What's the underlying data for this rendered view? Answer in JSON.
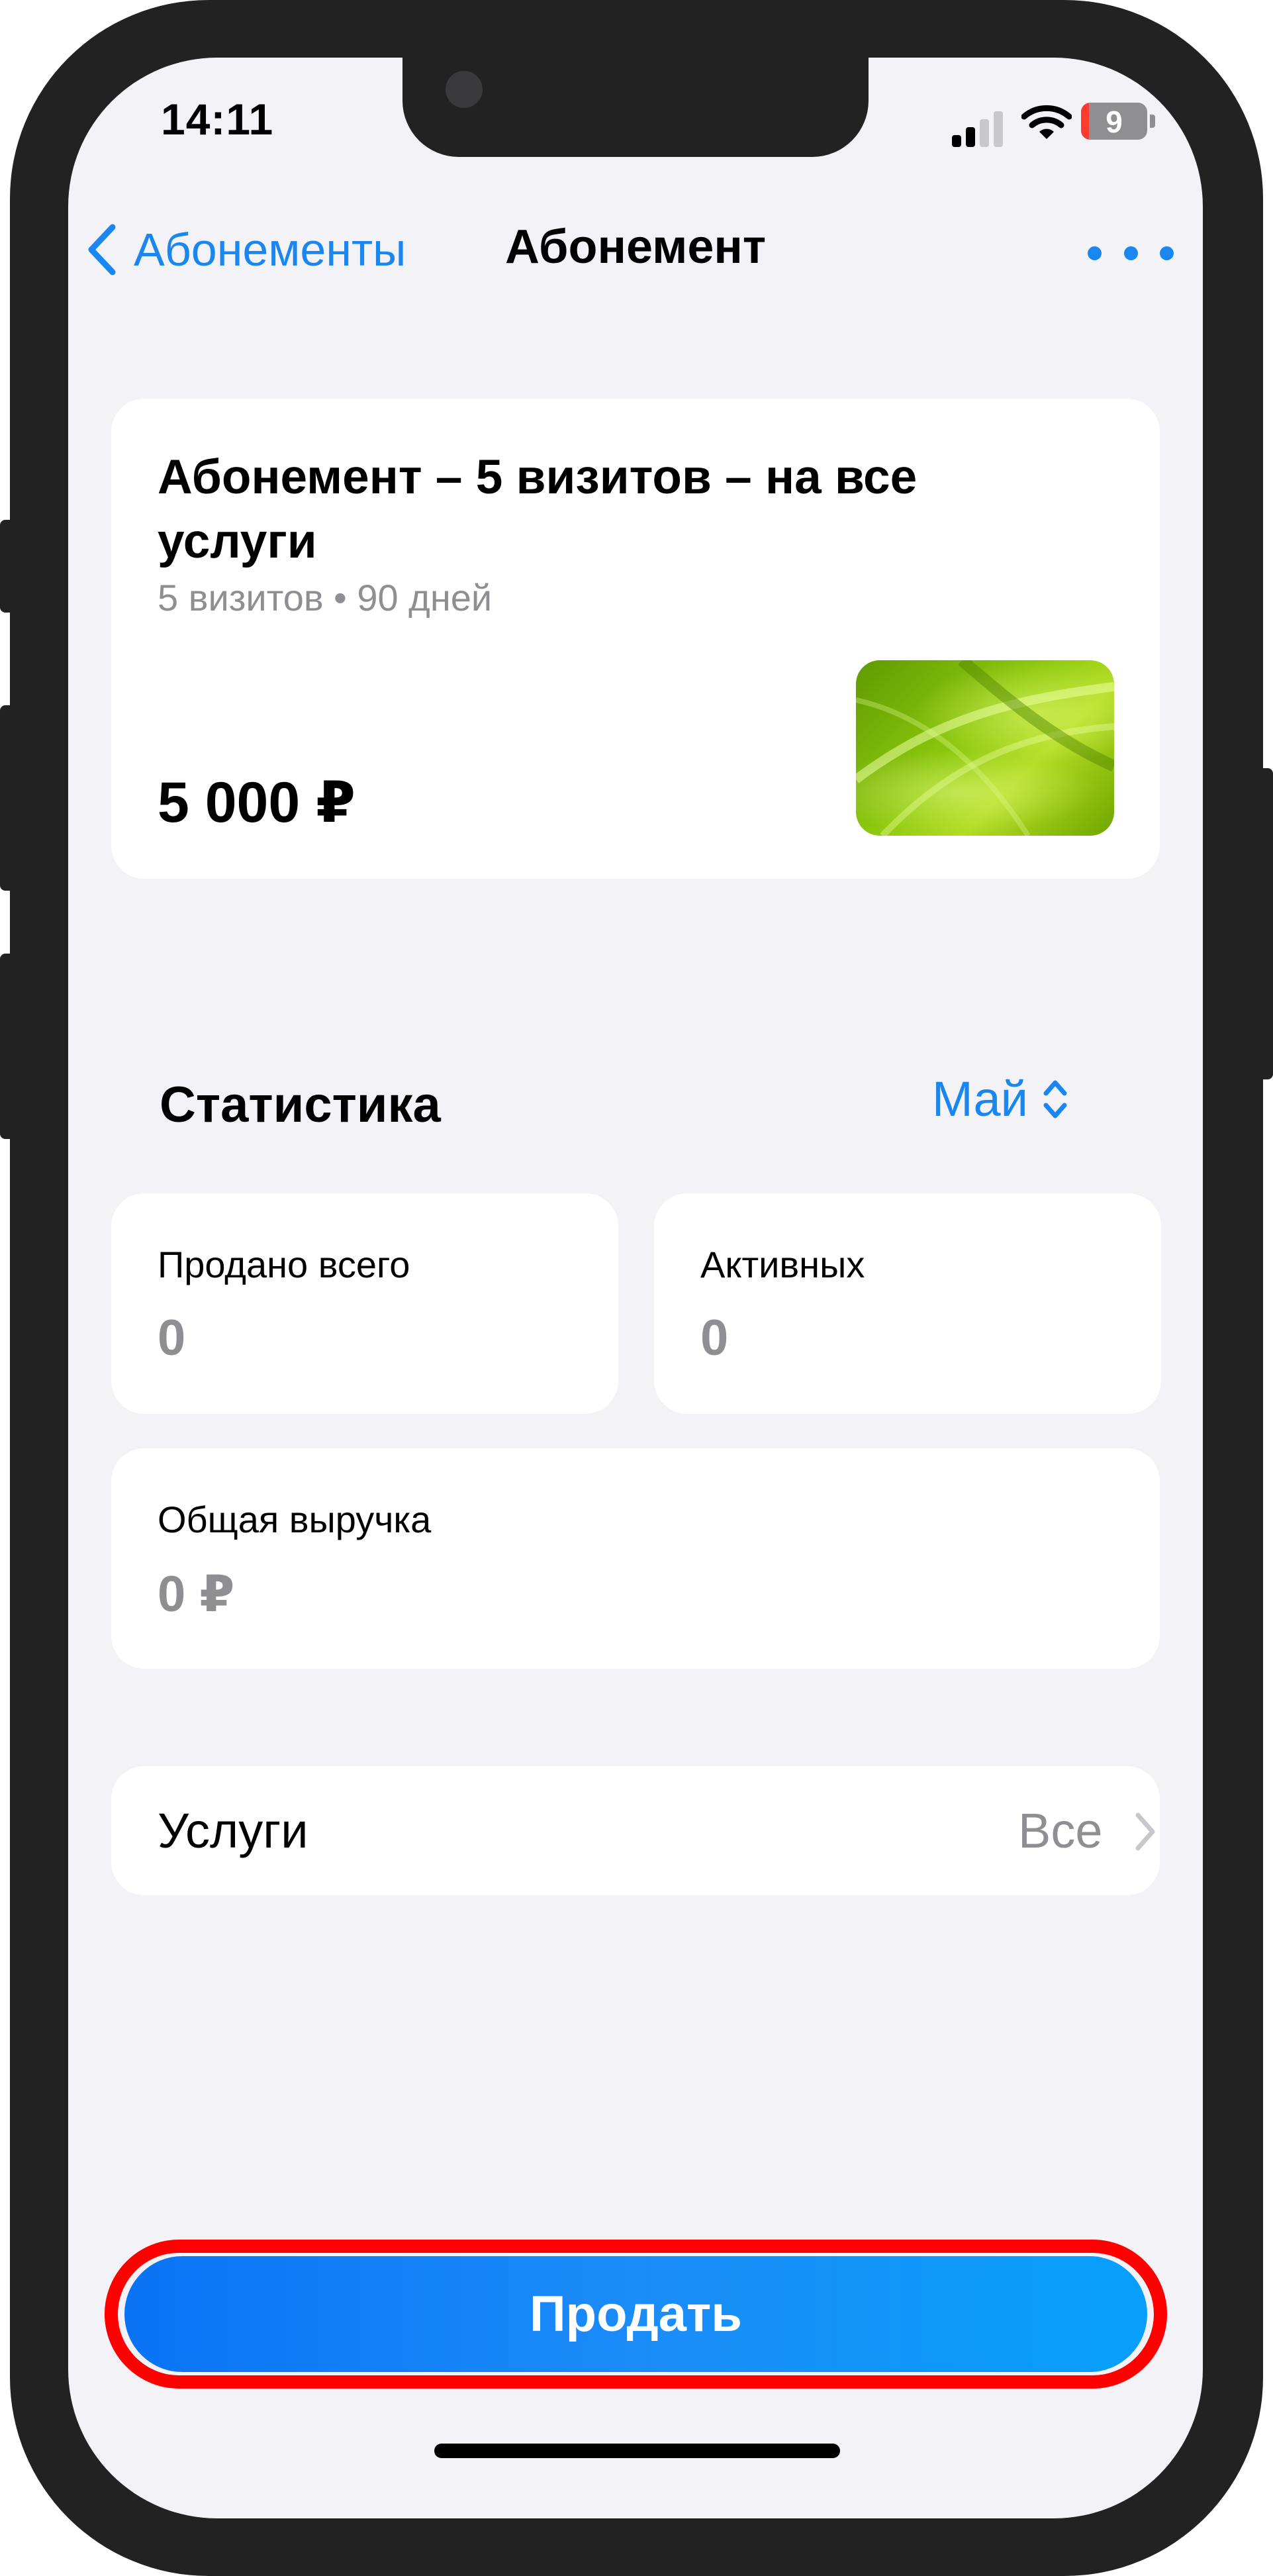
{
  "status_bar": {
    "time": "14:11",
    "battery_level": "9",
    "signal_icon": "cellular-signal-icon",
    "wifi_icon": "wifi-icon",
    "battery_icon": "battery-icon"
  },
  "nav": {
    "back_label": "Абонементы",
    "title": "Абонемент",
    "more_icon": "ellipsis-icon"
  },
  "subscription": {
    "name": "Абонемент – 5 визитов – на все услуги",
    "meta": "5 визитов • 90 дней",
    "price": "5 000 ₽"
  },
  "statistics": {
    "heading": "Статистика",
    "month": "Май",
    "sold_total_label": "Продано всего",
    "sold_total_value": "0",
    "active_label": "Активных",
    "active_value": "0",
    "revenue_label": "Общая выручка",
    "revenue_value": "0 ₽"
  },
  "services": {
    "label": "Услуги",
    "value": "Все"
  },
  "actions": {
    "sell_label": "Продать"
  },
  "colors": {
    "accent": "#1a86f0",
    "background": "#f2f2f7",
    "secondary_text": "#8e8e93",
    "highlight_outline": "#ff0000"
  }
}
